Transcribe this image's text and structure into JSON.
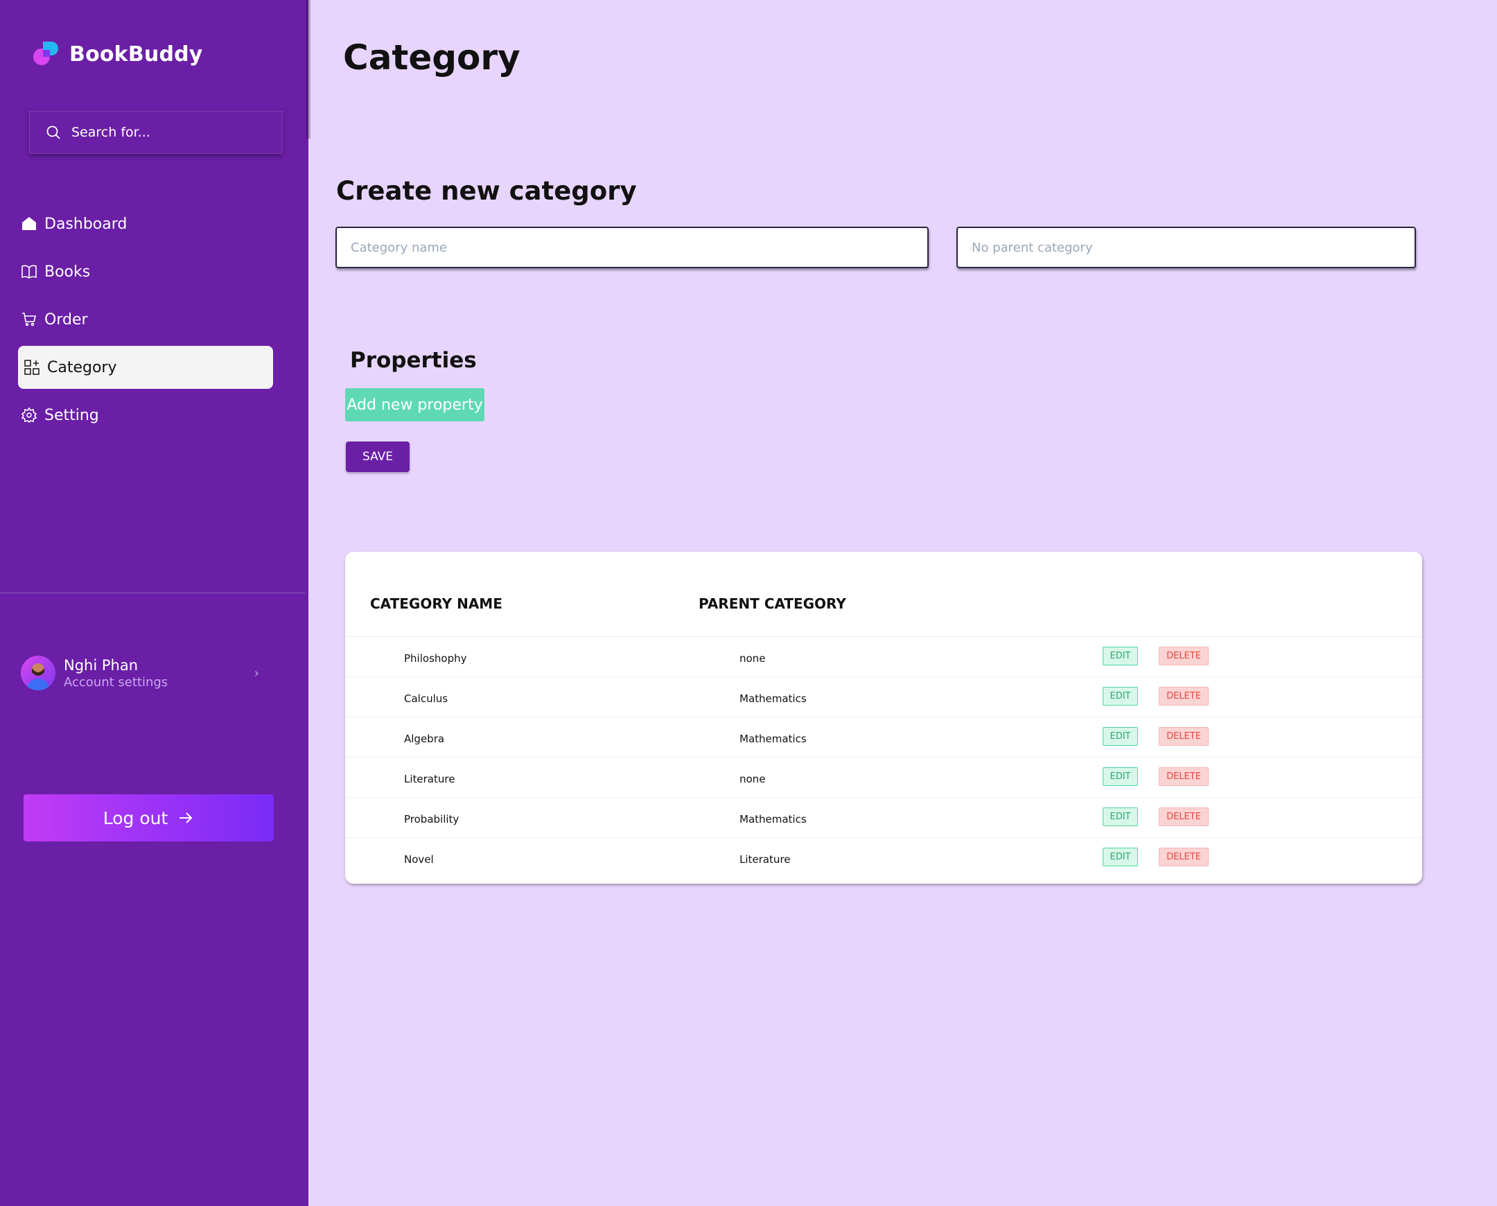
{
  "app": {
    "brand_name": "BookBuddy"
  },
  "sidebar": {
    "search_placeholder": "Search for...",
    "items": [
      {
        "label": "Dashboard",
        "icon": "home-icon"
      },
      {
        "label": "Books",
        "icon": "book-icon"
      },
      {
        "label": "Order",
        "icon": "cart-icon"
      },
      {
        "label": "Category",
        "icon": "category-icon",
        "active": true
      },
      {
        "label": "Setting",
        "icon": "gear-icon"
      }
    ],
    "profile": {
      "name": "Nghi Phan",
      "subtitle": "Account settings"
    },
    "logout_label": "Log out"
  },
  "main": {
    "title": "Category",
    "create": {
      "title": "Create new category",
      "name_placeholder": "Category name",
      "parent_value": "No parent category"
    },
    "properties": {
      "title": "Properties",
      "add_label": "Add new property",
      "save_label": "SAVE"
    },
    "table": {
      "columns": [
        "CATEGORY NAME",
        "PARENT CATEGORY"
      ],
      "edit_label": "EDIT",
      "delete_label": "DELETE",
      "rows": [
        {
          "name": "Philoshophy",
          "parent": "none"
        },
        {
          "name": "Calculus",
          "parent": "Mathematics"
        },
        {
          "name": "Algebra",
          "parent": "Mathematics"
        },
        {
          "name": "Literature",
          "parent": "none"
        },
        {
          "name": "Probability",
          "parent": "Mathematics"
        },
        {
          "name": "Novel",
          "parent": "Literature"
        }
      ]
    }
  },
  "colors": {
    "sidebar": "#6a1fa6",
    "background": "#e8d5fd",
    "accent_green": "#5fd9b4",
    "logout_gradient_start": "#c13bf5",
    "logout_gradient_end": "#7a2bf7"
  }
}
